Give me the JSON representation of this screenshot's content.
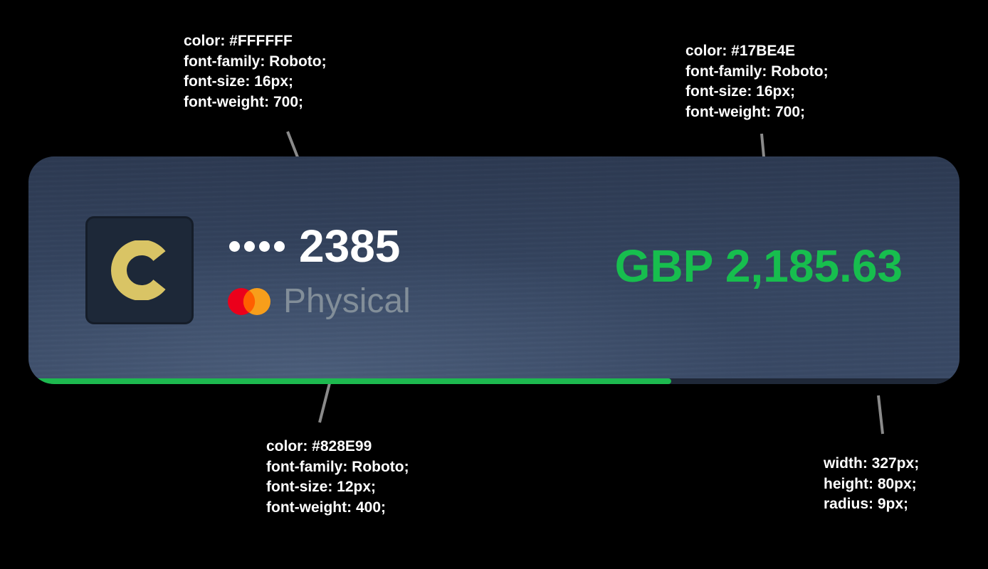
{
  "annotations": {
    "number_style": [
      "color: #FFFFFF",
      "font-family: Roboto;",
      "font-size: 16px;",
      "font-weight: 700;"
    ],
    "balance_style": [
      "color: #17BE4E",
      "font-family: Roboto;",
      "font-size: 16px;",
      "font-weight: 700;"
    ],
    "type_style": [
      "color: #828E99",
      "font-family: Roboto;",
      "font-size: 12px;",
      "font-weight: 400;"
    ],
    "card_size": [
      "width: 327px;",
      "height: 80px;",
      "radius: 9px;"
    ]
  },
  "card": {
    "logo_letter": "C",
    "logo_letter_color": "#D9C465",
    "masked_digits": "2385",
    "mask_dot_count": 4,
    "type_icon": "mastercard-icon",
    "type_label": "Physical",
    "balance": "GBP 2,185.63",
    "progress_fraction": 0.69
  },
  "colors": {
    "number": "#FFFFFF",
    "balance": "#17BE4E",
    "type_label": "#828E99",
    "progress": "#1DB94F",
    "mastercard_red": "#EB001B",
    "mastercard_orange": "#F79E1B"
  }
}
